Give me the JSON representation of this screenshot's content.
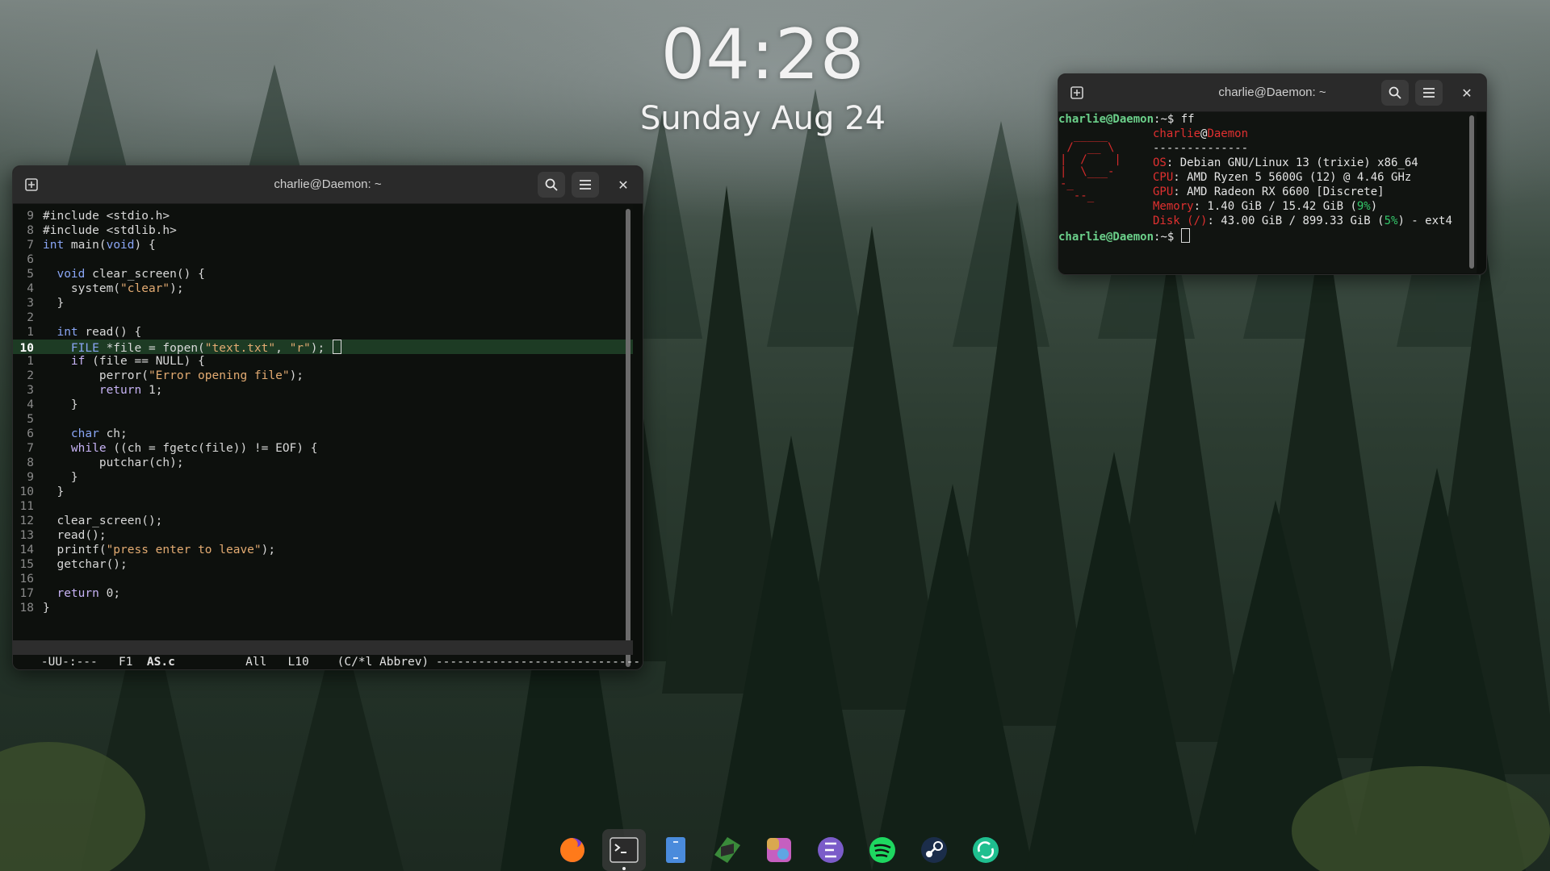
{
  "clock": {
    "time": "04:28",
    "date": "Sunday Aug 24"
  },
  "editor_window": {
    "title": "charlie@Daemon: ~",
    "lines": [
      {
        "n": "9",
        "t": "#include <stdio.h>"
      },
      {
        "n": "8",
        "t": "#include <stdlib.h>"
      },
      {
        "n": "7",
        "t": "int main(void) {"
      },
      {
        "n": "6",
        "t": ""
      },
      {
        "n": "5",
        "t": "  void clear_screen() {"
      },
      {
        "n": "4",
        "t": "    system(\"clear\");"
      },
      {
        "n": "3",
        "t": "  }"
      },
      {
        "n": "2",
        "t": ""
      },
      {
        "n": "1",
        "t": "  int read() {"
      },
      {
        "n": "10",
        "t": "    FILE *file = fopen(\"text.txt\", \"r\");",
        "current": true
      },
      {
        "n": "1",
        "t": "    if (file == NULL) {"
      },
      {
        "n": "2",
        "t": "        perror(\"Error opening file\");"
      },
      {
        "n": "3",
        "t": "        return 1;"
      },
      {
        "n": "4",
        "t": "    }"
      },
      {
        "n": "5",
        "t": ""
      },
      {
        "n": "6",
        "t": "    char ch;"
      },
      {
        "n": "7",
        "t": "    while ((ch = fgetc(file)) != EOF) {"
      },
      {
        "n": "8",
        "t": "        putchar(ch);"
      },
      {
        "n": "9",
        "t": "    }"
      },
      {
        "n": "10",
        "t": "  }"
      },
      {
        "n": "11",
        "t": ""
      },
      {
        "n": "12",
        "t": "  clear_screen();"
      },
      {
        "n": "13",
        "t": "  read();"
      },
      {
        "n": "14",
        "t": "  printf(\"press enter to leave\");"
      },
      {
        "n": "15",
        "t": "  getchar();"
      },
      {
        "n": "16",
        "t": ""
      },
      {
        "n": "17",
        "t": "  return 0;"
      },
      {
        "n": "18",
        "t": "}"
      }
    ],
    "modeline": {
      "status": "-UU-:---",
      "frame": "F1",
      "buffer": "AS.c",
      "position": "All",
      "line": "L10",
      "mode": "(C/*l Abbrev) -----------------------------"
    }
  },
  "terminal_window": {
    "title": "charlie@Daemon: ~",
    "prompt_user": "charlie@Daemon",
    "prompt_rest": ":~$ ",
    "command": "ff",
    "fetch": {
      "user": "charlie",
      "at": "@",
      "host": "Daemon",
      "separator": "--------------",
      "rows": [
        {
          "key": "OS",
          "val": ": Debian GNU/Linux 13 (trixie) x86_64"
        },
        {
          "key": "CPU",
          "val": ": AMD Ryzen 5 5600G (12) @ 4.46 GHz"
        },
        {
          "key": "GPU",
          "val": ": AMD Radeon RX 6600 [Discrete]"
        }
      ],
      "memory": {
        "key": "Memory",
        "val": ": 1.40 GiB / 15.42 GiB (",
        "pct": "9%",
        "tail": ")"
      },
      "disk": {
        "key": "Disk (/)",
        "val": ": 43.00 GiB / 899.33 GiB (",
        "pct": "5%",
        "tail": ") - ext4"
      },
      "logo": "  _____\n /  __ \\\n|  /    |\n|  \\___-\n-_\n  --_"
    },
    "prompt2": "charlie@Daemon",
    "prompt2_rest": ":~$ "
  },
  "dock": {
    "items": [
      {
        "name": "firefox-icon",
        "color": "#ff7a1a"
      },
      {
        "name": "terminal-icon",
        "color": "#2b2b2b",
        "active": true
      },
      {
        "name": "file-manager-icon",
        "color": "#4a8bdc"
      },
      {
        "name": "minecraft-icon",
        "color": "#3a8a3a"
      },
      {
        "name": "color-picker-icon",
        "color": "#d9a84f"
      },
      {
        "name": "emacs-icon",
        "color": "#7b5cc9"
      },
      {
        "name": "spotify-icon",
        "color": "#1ed760"
      },
      {
        "name": "steam-icon",
        "color": "#1b2d4a"
      },
      {
        "name": "sync-icon",
        "color": "#1fbf8f"
      }
    ]
  }
}
